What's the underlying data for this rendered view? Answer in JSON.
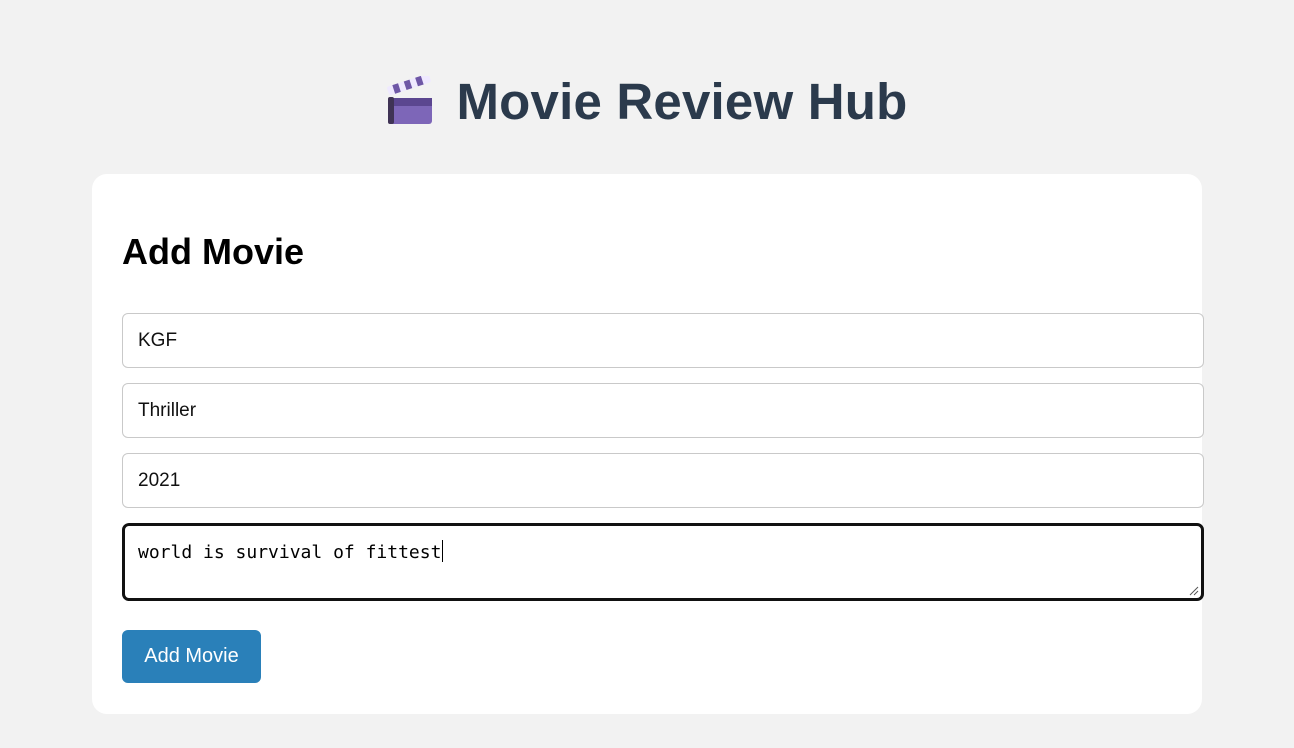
{
  "header": {
    "title": "Movie Review Hub",
    "icon": "clapperboard-icon"
  },
  "form": {
    "heading": "Add Movie",
    "fields": [
      {
        "name": "title",
        "value": "KGF"
      },
      {
        "name": "genre",
        "value": "Thriller"
      },
      {
        "name": "year",
        "value": "2021"
      }
    ],
    "review": {
      "value": "world is survival of fittest"
    },
    "submit_label": "Add Movie"
  },
  "colors": {
    "background": "#f2f2f2",
    "title": "#2b3a4c",
    "button": "#2a80b9",
    "card": "#ffffff"
  }
}
